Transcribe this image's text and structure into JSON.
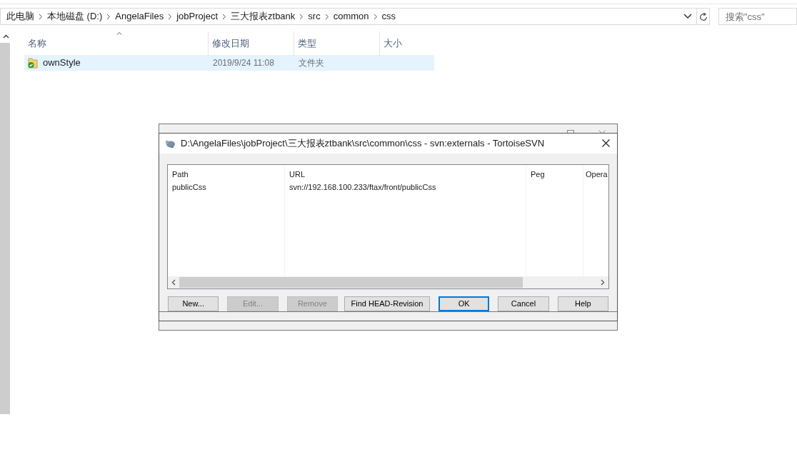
{
  "explorer": {
    "breadcrumbs": [
      "此电脑",
      "本地磁盘 (D:)",
      "AngelaFiles",
      "jobProject",
      "三大报表ztbank",
      "src",
      "common",
      "css"
    ],
    "search": {
      "placeholder": "搜索\"css\""
    },
    "columns": [
      {
        "label": "名称",
        "sorted": true
      },
      {
        "label": "修改日期",
        "sorted": false
      },
      {
        "label": "类型",
        "sorted": false
      },
      {
        "label": "大小",
        "sorted": false
      }
    ],
    "rows": [
      {
        "name": "ownStyle",
        "date": "2019/9/24 11:08",
        "type": "文件夹",
        "selected": true
      }
    ]
  },
  "dialog": {
    "title": "D:\\AngelaFiles\\jobProject\\三大报表ztbank\\src\\common\\css - svn:externals - TortoiseSVN",
    "columns": [
      "Path",
      "URL",
      "Peg",
      "Opera"
    ],
    "rows": [
      {
        "path": "publicCss",
        "url": "svn://192.168.100.233/ftax/front/publicCss"
      }
    ],
    "buttons": [
      {
        "label": "New...",
        "disabled": false,
        "default": false
      },
      {
        "label": "Edit...",
        "disabled": true,
        "default": false
      },
      {
        "label": "Remove",
        "disabled": true,
        "default": false
      },
      {
        "label": "Find HEAD-Revision",
        "disabled": false,
        "default": false
      },
      {
        "label": "OK",
        "disabled": false,
        "default": true
      },
      {
        "label": "Cancel",
        "disabled": false,
        "default": false
      },
      {
        "label": "Help",
        "disabled": false,
        "default": false
      }
    ]
  }
}
